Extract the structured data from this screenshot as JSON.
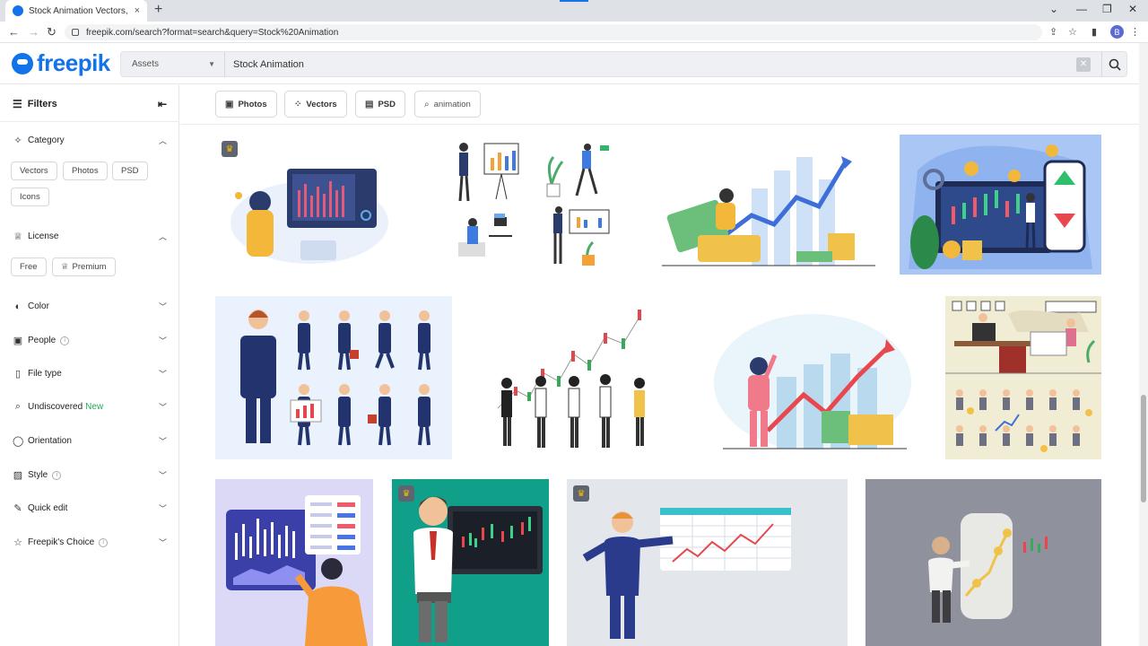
{
  "browser": {
    "tab_title": "Stock Animation Vectors, Photos",
    "tab_close": "×",
    "new_tab": "+",
    "url": "freepik.com/search?format=search&query=Stock%20Animation",
    "avatar": "B",
    "win_min": "⌄",
    "win_restore": "—",
    "win_max": "❐",
    "win_close": "✕"
  },
  "site": {
    "logo": "freepik",
    "search_scope": "Assets",
    "search_value": "Stock Animation"
  },
  "sidebar": {
    "title": "Filters",
    "sections": {
      "category": "Category",
      "license": "License",
      "color": "Color",
      "people": "People",
      "file_type": "File type",
      "undiscovered": "Undiscovered",
      "undiscovered_badge": "New",
      "orientation": "Orientation",
      "style": "Style",
      "quick_edit": "Quick edit",
      "freepiks_choice": "Freepik's Choice"
    },
    "category_chips": [
      "Vectors",
      "Photos",
      "PSD",
      "Icons"
    ],
    "license_chips": [
      "Free",
      "Premium"
    ]
  },
  "filter_bar": [
    "Photos",
    "Vectors",
    "PSD",
    "animation"
  ],
  "grid_items": [
    {
      "premium": true,
      "bg": "#ffffff"
    },
    {
      "premium": false,
      "bg": "#ffffff"
    },
    {
      "premium": false,
      "bg": "#ffffff"
    },
    {
      "premium": false,
      "bg": "#a9c6f5"
    },
    {
      "premium": false,
      "bg": "#e9f2fd"
    },
    {
      "premium": false,
      "bg": "#ffffff"
    },
    {
      "premium": false,
      "bg": "#ffffff"
    },
    {
      "premium": false,
      "bg": "#f1ecd4"
    },
    {
      "premium": false,
      "bg": "#dcd9f6"
    },
    {
      "premium": true,
      "bg": "#10a08a"
    },
    {
      "premium": true,
      "bg": "#dfe3e7"
    },
    {
      "premium": false,
      "bg": "#8f929c"
    }
  ],
  "colors": {
    "brand": "#1273eb",
    "new_badge": "#22a85a",
    "crown": "#f5b700"
  }
}
